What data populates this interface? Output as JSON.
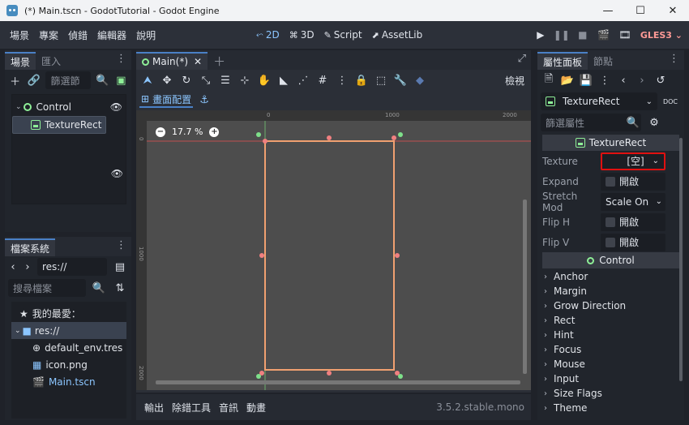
{
  "window": {
    "title": "(*) Main.tscn - GodotTutorial - Godot Engine",
    "min": "—",
    "max": "☐",
    "close": "✕"
  },
  "menu": {
    "items": [
      "場景",
      "專案",
      "偵錯",
      "編輯器",
      "說明"
    ]
  },
  "modes": [
    {
      "glyph": "⬿",
      "label": "2D"
    },
    {
      "glyph": "⌘",
      "label": "3D"
    },
    {
      "glyph": "✎",
      "label": "Script"
    },
    {
      "glyph": "⬈",
      "label": "AssetLib"
    }
  ],
  "play": {
    "renderer": "GLES3 ⌄"
  },
  "scene_dock": {
    "tabs": [
      "場景",
      "匯入"
    ],
    "filter_placeholder": "篩選節",
    "nodes": [
      {
        "label": "Control"
      },
      {
        "label": "TextureRect"
      }
    ]
  },
  "filesystem": {
    "tab": "檔案系統",
    "path": "res://",
    "search_placeholder": "搜尋檔案",
    "favorites_label": "我的最愛：",
    "root": "res://",
    "files": [
      "default_env.tres",
      "icon.png",
      "Main.tscn"
    ]
  },
  "editor": {
    "scene_tab": "Main(*)",
    "view_label": "檢視",
    "layout_label": "畫面配置",
    "zoom": "17.7 %",
    "ruler_top": [
      "0",
      "1000",
      "2000"
    ],
    "ruler_left": [
      "0",
      "1000",
      "2000"
    ]
  },
  "bottom": {
    "items": [
      "輸出",
      "除錯工具",
      "音訊",
      "動畫"
    ],
    "version": "3.5.2.stable.mono"
  },
  "inspector": {
    "tabs": [
      "屬性面板",
      "節點"
    ],
    "node_name": "TextureRect",
    "filter_placeholder": "篩選屬性",
    "section_texture_rect": "TextureRect",
    "props": [
      {
        "label": "Texture",
        "value": "[空]"
      },
      {
        "label": "Expand",
        "value": "開啟"
      },
      {
        "label": "Stretch Mod",
        "value": "Scale On"
      },
      {
        "label": "Flip H",
        "value": "開啟"
      },
      {
        "label": "Flip V",
        "value": "開啟"
      }
    ],
    "section_control": "Control",
    "groups": [
      "Anchor",
      "Margin",
      "Grow Direction",
      "Rect",
      "Hint",
      "Focus",
      "Mouse",
      "Input",
      "Size Flags",
      "Theme"
    ]
  }
}
